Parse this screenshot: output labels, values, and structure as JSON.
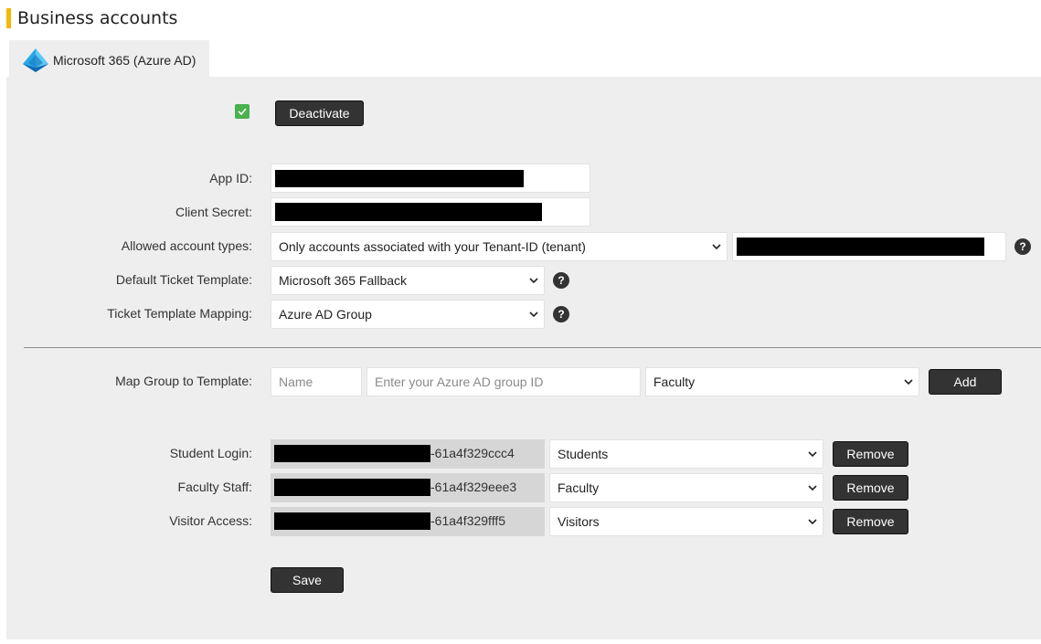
{
  "page": {
    "title": "Business accounts"
  },
  "tab": {
    "label": "Microsoft 365 (Azure AD)",
    "icon": "azure-ad-icon"
  },
  "activation": {
    "checked": true,
    "deactivate_label": "Deactivate"
  },
  "form": {
    "app_id_label": "App ID:",
    "client_secret_label": "Client Secret:",
    "allowed_types_label": "Allowed account types:",
    "allowed_types_value": "Only accounts associated with your Tenant-ID (tenant)",
    "default_template_label": "Default Ticket Template:",
    "default_template_value": "Microsoft 365 Fallback",
    "mapping_label": "Ticket Template Mapping:",
    "mapping_value": "Azure AD Group",
    "help_glyph": "?"
  },
  "map_group": {
    "label": "Map Group to Template:",
    "name_placeholder": "Name",
    "group_id_placeholder": "Enter your Azure AD group ID",
    "template_value": "Faculty",
    "add_label": "Add"
  },
  "mappings": [
    {
      "label": "Student Login:",
      "group_id_suffix": "-61a4f329ccc4",
      "template": "Students",
      "remove_label": "Remove"
    },
    {
      "label": "Faculty Staff:",
      "group_id_suffix": "-61a4f329eee3",
      "template": "Faculty",
      "remove_label": "Remove"
    },
    {
      "label": "Visitor Access:",
      "group_id_suffix": "-61a4f329fff5",
      "template": "Visitors",
      "remove_label": "Remove"
    }
  ],
  "save_label": "Save",
  "colors": {
    "accent": "#f5b800",
    "checkbox": "#49b14d",
    "button": "#333333",
    "panel": "#eeeeee"
  }
}
